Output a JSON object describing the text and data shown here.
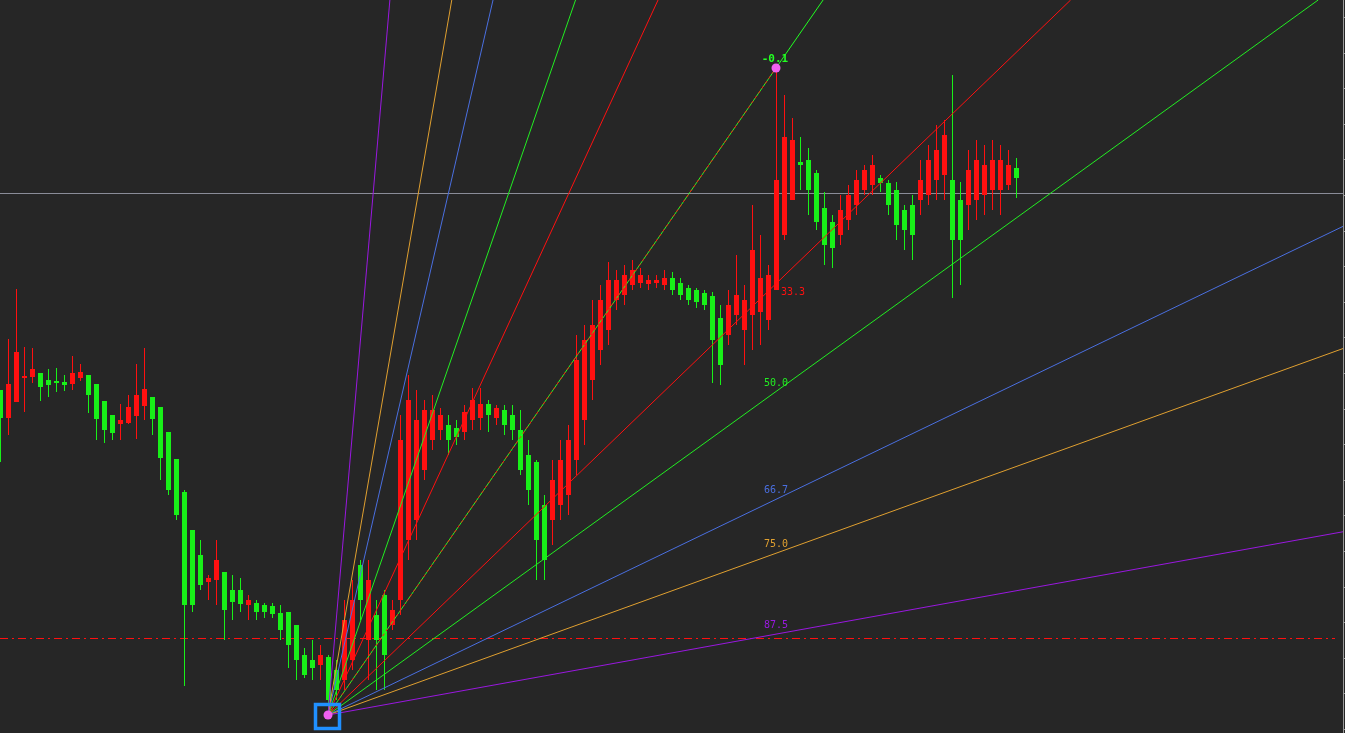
{
  "chart": {
    "anchor_label": {
      "text": "-0.1",
      "color": "#22ff22"
    },
    "fan_levels": [
      {
        "label": "33.3",
        "color": "#ff1010"
      },
      {
        "label": "50.0",
        "color": "#22ee22"
      },
      {
        "label": "66.7",
        "color": "#4a6fe0"
      },
      {
        "label": "75.0",
        "color": "#e0a030"
      },
      {
        "label": "87.5",
        "color": "#9a18e0"
      }
    ]
  }
}
